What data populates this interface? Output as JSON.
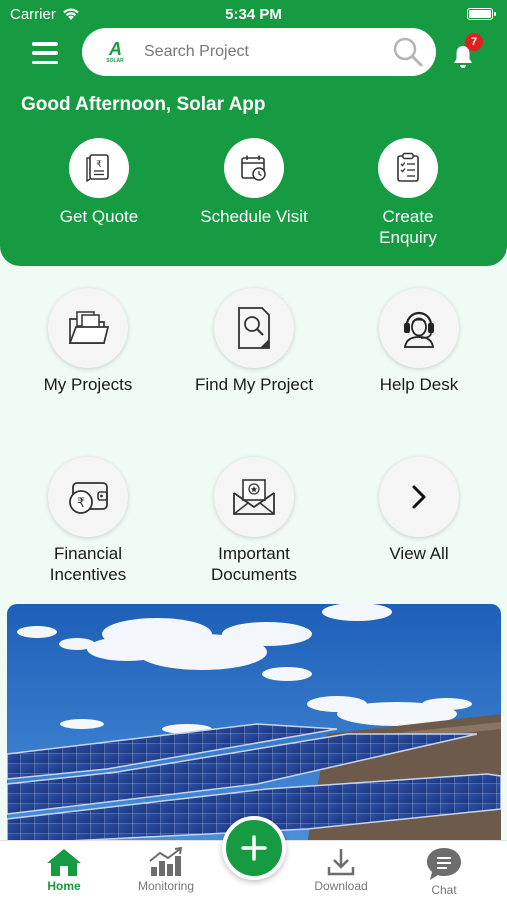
{
  "status_bar": {
    "carrier": "Carrier",
    "time": "5:34 PM"
  },
  "header": {
    "logo_text": "A",
    "logo_sub": "SOLAR",
    "search_placeholder": "Search Project",
    "notification_count": "7",
    "greeting": "Good Afternoon, Solar App"
  },
  "quick_actions": [
    {
      "label": "Get Quote",
      "icon": "quote-document-icon"
    },
    {
      "label": "Schedule Visit",
      "icon": "calendar-clock-icon"
    },
    {
      "label": "Create Enquiry",
      "icon": "clipboard-checklist-icon"
    }
  ],
  "grid": [
    {
      "label": "My Projects",
      "icon": "folder-documents-icon"
    },
    {
      "label": "Find My Project",
      "icon": "document-search-icon"
    },
    {
      "label": "Help Desk",
      "icon": "support-agent-icon"
    },
    {
      "label": "Financial Incentives",
      "icon": "rupee-wallet-icon"
    },
    {
      "label": "Important Documents",
      "icon": "envelope-document-icon"
    },
    {
      "label": "View All",
      "icon": "chevron-right-icon"
    }
  ],
  "bottom_nav": [
    {
      "label": "Home",
      "icon": "home-icon",
      "active": true
    },
    {
      "label": "Monitoring",
      "icon": "bar-chart-icon"
    },
    {
      "label": "Download",
      "icon": "download-icon"
    },
    {
      "label": "Chat",
      "icon": "chat-bubble-icon"
    }
  ],
  "colors": {
    "brand_green": "#169a42",
    "badge_red": "#e02020"
  }
}
